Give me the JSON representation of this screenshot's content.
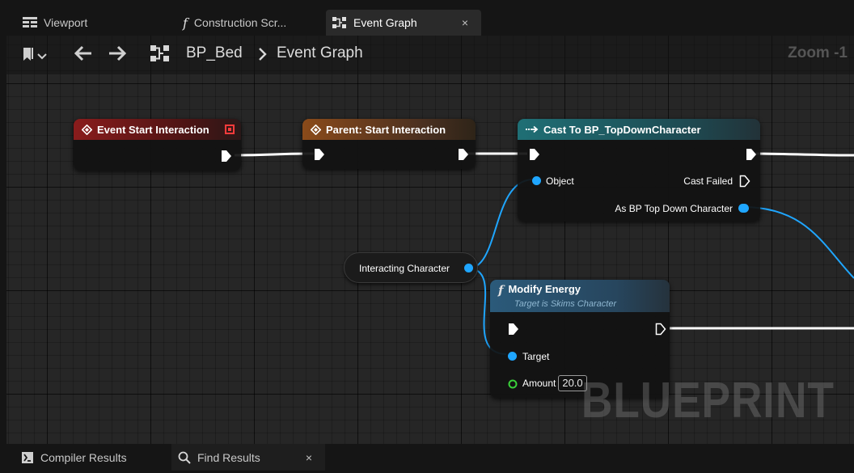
{
  "tabs": [
    {
      "label": "Viewport",
      "icon": "viewport-grid-icon"
    },
    {
      "label": "Construction Scr...",
      "icon": "function-icon"
    },
    {
      "label": "Event Graph",
      "icon": "event-graph-icon",
      "active": true,
      "close": "×"
    }
  ],
  "toolbar": {
    "breadcrumb_root": "BP_Bed",
    "breadcrumb_current": "Event Graph",
    "zoom": "Zoom -1"
  },
  "nodes": {
    "event_start": {
      "title": "Event Start Interaction"
    },
    "parent_start": {
      "title": "Parent: Start Interaction"
    },
    "cast": {
      "title": "Cast To BP_TopDownCharacter",
      "pin_object": "Object",
      "pin_cast_failed": "Cast Failed",
      "pin_as": "As BP Top Down Character"
    },
    "var_interacting": {
      "label": "Interacting Character"
    },
    "modify_energy": {
      "title": "Modify Energy",
      "subtitle": "Target is Skims Character",
      "pin_target": "Target",
      "pin_amount": "Amount",
      "amount_value": "20.0"
    }
  },
  "watermark": "BLUEPRINT",
  "bottom_tabs": [
    {
      "label": "Compiler Results",
      "icon": "compiler-results-icon"
    },
    {
      "label": "Find Results",
      "icon": "search-icon",
      "close": "×"
    }
  ],
  "colors": {
    "event_red": "#8a1c1c",
    "parent_orange": "#8a4a1a",
    "cast_teal": "#1f6f75",
    "function_blue": "#2b5a7a",
    "object_pin": "#1fa6ff",
    "float_pin": "#3ad23a",
    "wire_exec": "#ffffff",
    "graph_bg": "#262626"
  }
}
